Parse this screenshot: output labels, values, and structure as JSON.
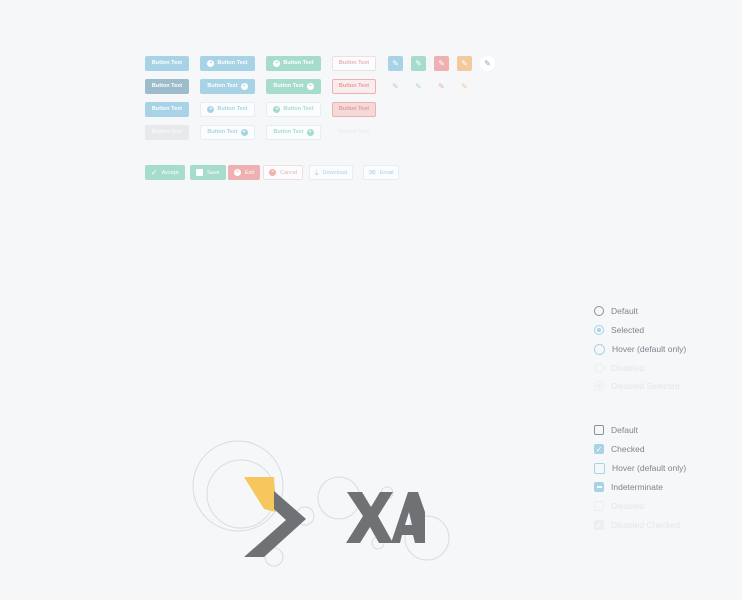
{
  "button_grid": {
    "label": "Button Text"
  },
  "action_buttons": {
    "accept": "Accept",
    "save": "Save",
    "exit": "Exit",
    "cancel": "Cancel",
    "download": "Download",
    "email": "Email"
  },
  "radio_group": {
    "items": [
      "Default",
      "Selected",
      "Hover (default only)",
      "Disabled",
      "Disabled Selected"
    ]
  },
  "checkbox_group": {
    "items": [
      "Default",
      "Checked",
      "Hover (default only)",
      "Indeterminate",
      "Disabled",
      "Disabled Checked"
    ]
  },
  "colors": {
    "blue": "#a8d3e6",
    "blue_dark": "#9cbccc",
    "teal": "#a6dccb",
    "red": "#eeb0b0",
    "orange": "#f3c99d",
    "gray": "#e7e9eb",
    "logo_gray": "#6f7275",
    "logo_yellow": "#f6c75d"
  },
  "icons": {
    "plus": "plus-circle-icon",
    "edit": "pencil-icon",
    "accept": "checkmark-icon",
    "save": "floppy-disk-icon",
    "exit": "close-circle-icon",
    "download": "download-icon",
    "email": "envelope-icon"
  }
}
